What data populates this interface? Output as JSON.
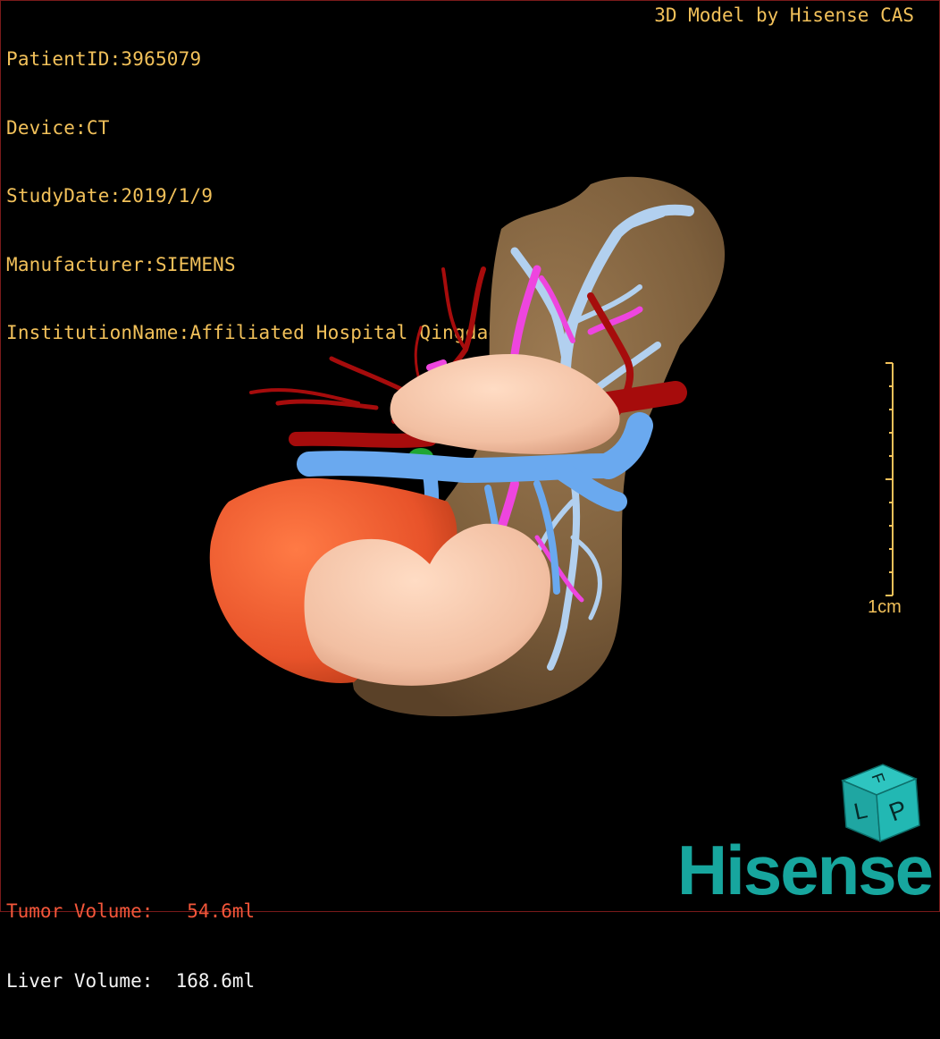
{
  "study_info": {
    "patient_id": "PatientID:3965079",
    "device": "Device:CT",
    "study_date": "StudyDate:2019/1/9",
    "manufacturer": "Manufacturer:SIEMENS",
    "institution": "InstitutionName:Affiliated Hospital Qingdao University-C"
  },
  "model_credit": "3D Model by Hisense CAS",
  "volumes": {
    "tumor": "Tumor Volume:   54.6ml",
    "liver": "Liver Volume:  168.6ml"
  },
  "scale_bar": {
    "label": "1cm"
  },
  "orientation_cube": {
    "front_letter": "L",
    "right_letter": "P",
    "top_letter": "F"
  },
  "brand": "Hisense",
  "colors": {
    "info_text": "#f2c15a",
    "tumor_text": "#f3563a",
    "liver": "#8a6a45",
    "tumor": "#f05a2a",
    "kidney": "#f4c2a6",
    "artery": "#a80c0c",
    "portal_vein": "#6aaaf0",
    "hepatic_vein": "#b0d0f0",
    "bile_duct": "#ee44dd",
    "gallbladder": "#22aa33",
    "brand": "#17a69e"
  }
}
